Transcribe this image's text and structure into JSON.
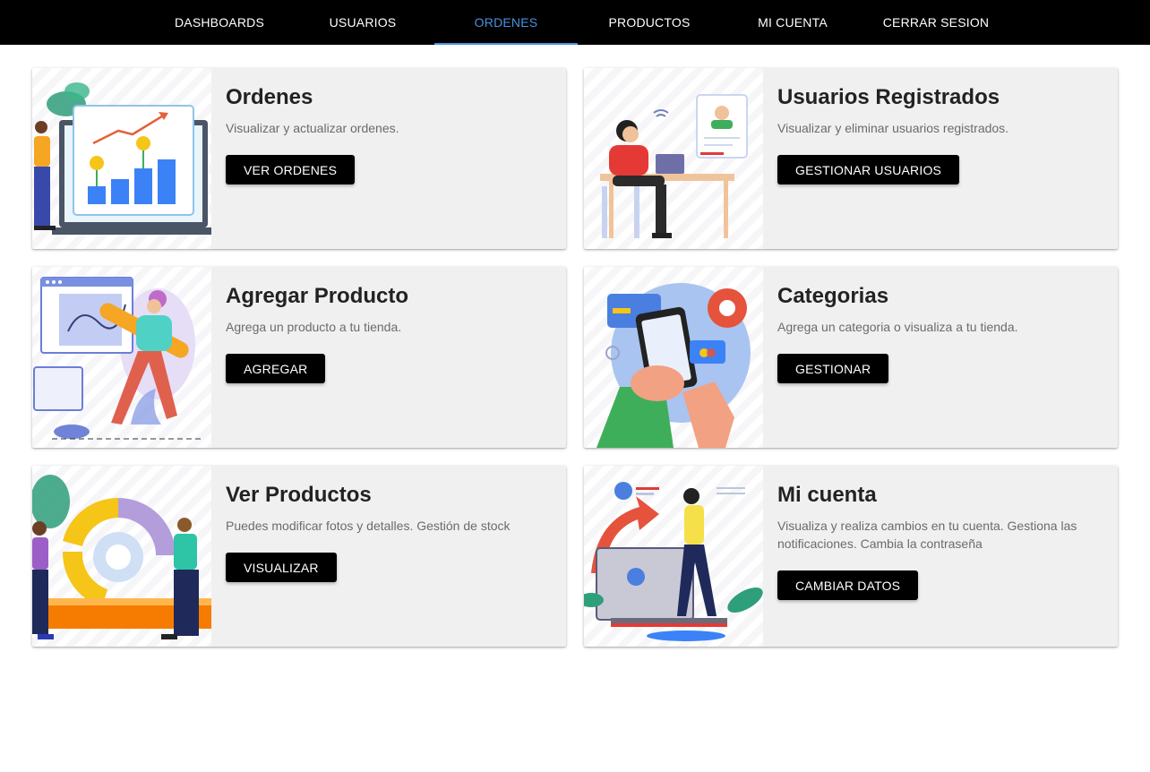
{
  "nav": {
    "tabs": [
      {
        "label": "DASHBOARDS"
      },
      {
        "label": "USUARIOS"
      },
      {
        "label": "ORDENES",
        "active": true
      },
      {
        "label": "PRODUCTOS"
      },
      {
        "label": "MI CUENTA"
      },
      {
        "label": "CERRAR SESION"
      }
    ]
  },
  "colors": {
    "navbar": "#000000",
    "active_tab": "#4a90e2",
    "card_bg": "#f0f0f0",
    "button_bg": "#000000"
  },
  "cards": [
    {
      "title": "Ordenes",
      "description": "Visualizar y actualizar ordenes.",
      "button": "VER ORDENES",
      "illustration": "sales-chart-illustration"
    },
    {
      "title": "Usuarios Registrados",
      "description": "Visualizar y eliminar usuarios registrados.",
      "button": "GESTIONAR USUARIOS",
      "illustration": "woman-at-laptop-illustration"
    },
    {
      "title": "Agregar Producto",
      "description": "Agrega un producto a tu tienda.",
      "button": "AGREGAR",
      "illustration": "designer-with-pencil-illustration"
    },
    {
      "title": "Categorias",
      "description": "Agrega un categoria o visualiza a tu tienda.",
      "button": "GESTIONAR",
      "illustration": "phone-shopping-illustration"
    },
    {
      "title": "Ver Productos",
      "description": "Puedes modificar fotos y detalles. Gestión de stock",
      "button": "VISUALIZAR",
      "illustration": "gear-cycle-illustration"
    },
    {
      "title": "Mi cuenta",
      "description": "Visualiza y realiza cambios en tu cuenta. Gestiona las notificaciones. Cambia la contraseña",
      "button": "CAMBIAR DATOS",
      "illustration": "account-settings-illustration"
    }
  ]
}
